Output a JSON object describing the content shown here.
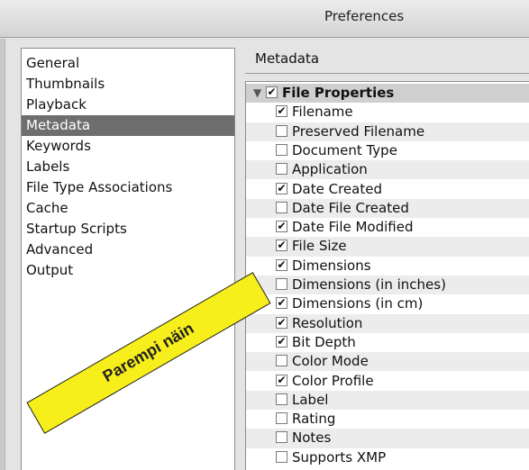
{
  "window": {
    "title": "Preferences"
  },
  "sidebar": {
    "items": [
      {
        "label": "General"
      },
      {
        "label": "Thumbnails"
      },
      {
        "label": "Playback"
      },
      {
        "label": "Metadata",
        "selected": true
      },
      {
        "label": "Keywords"
      },
      {
        "label": "Labels"
      },
      {
        "label": "File Type Associations"
      },
      {
        "label": "Cache"
      },
      {
        "label": "Startup Scripts"
      },
      {
        "label": "Advanced"
      },
      {
        "label": "Output"
      }
    ]
  },
  "metadata": {
    "section_title": "Metadata",
    "group": {
      "label": "File Properties",
      "checked": true,
      "expanded": true,
      "icon": "disclosure-triangle-icon"
    },
    "fields": [
      {
        "label": "Filename",
        "checked": true
      },
      {
        "label": "Preserved Filename",
        "checked": false
      },
      {
        "label": "Document Type",
        "checked": false
      },
      {
        "label": "Application",
        "checked": false
      },
      {
        "label": "Date Created",
        "checked": true
      },
      {
        "label": "Date File Created",
        "checked": false
      },
      {
        "label": "Date File Modified",
        "checked": true
      },
      {
        "label": "File Size",
        "checked": true
      },
      {
        "label": "Dimensions",
        "checked": true
      },
      {
        "label": "Dimensions (in inches)",
        "checked": false
      },
      {
        "label": "Dimensions (in cm)",
        "checked": true
      },
      {
        "label": "Resolution",
        "checked": true
      },
      {
        "label": "Bit Depth",
        "checked": true
      },
      {
        "label": "Color Mode",
        "checked": false
      },
      {
        "label": "Color Profile",
        "checked": true
      },
      {
        "label": "Label",
        "checked": false
      },
      {
        "label": "Rating",
        "checked": false
      },
      {
        "label": "Notes",
        "checked": false
      },
      {
        "label": "Supports XMP",
        "checked": false
      }
    ]
  },
  "annotation": {
    "text": "Parempi näin",
    "color": "#f7ef1c"
  },
  "colors": {
    "selection": "#6e6e6e",
    "row_alt": "#ececec",
    "group_row": "#cfcfcf"
  }
}
